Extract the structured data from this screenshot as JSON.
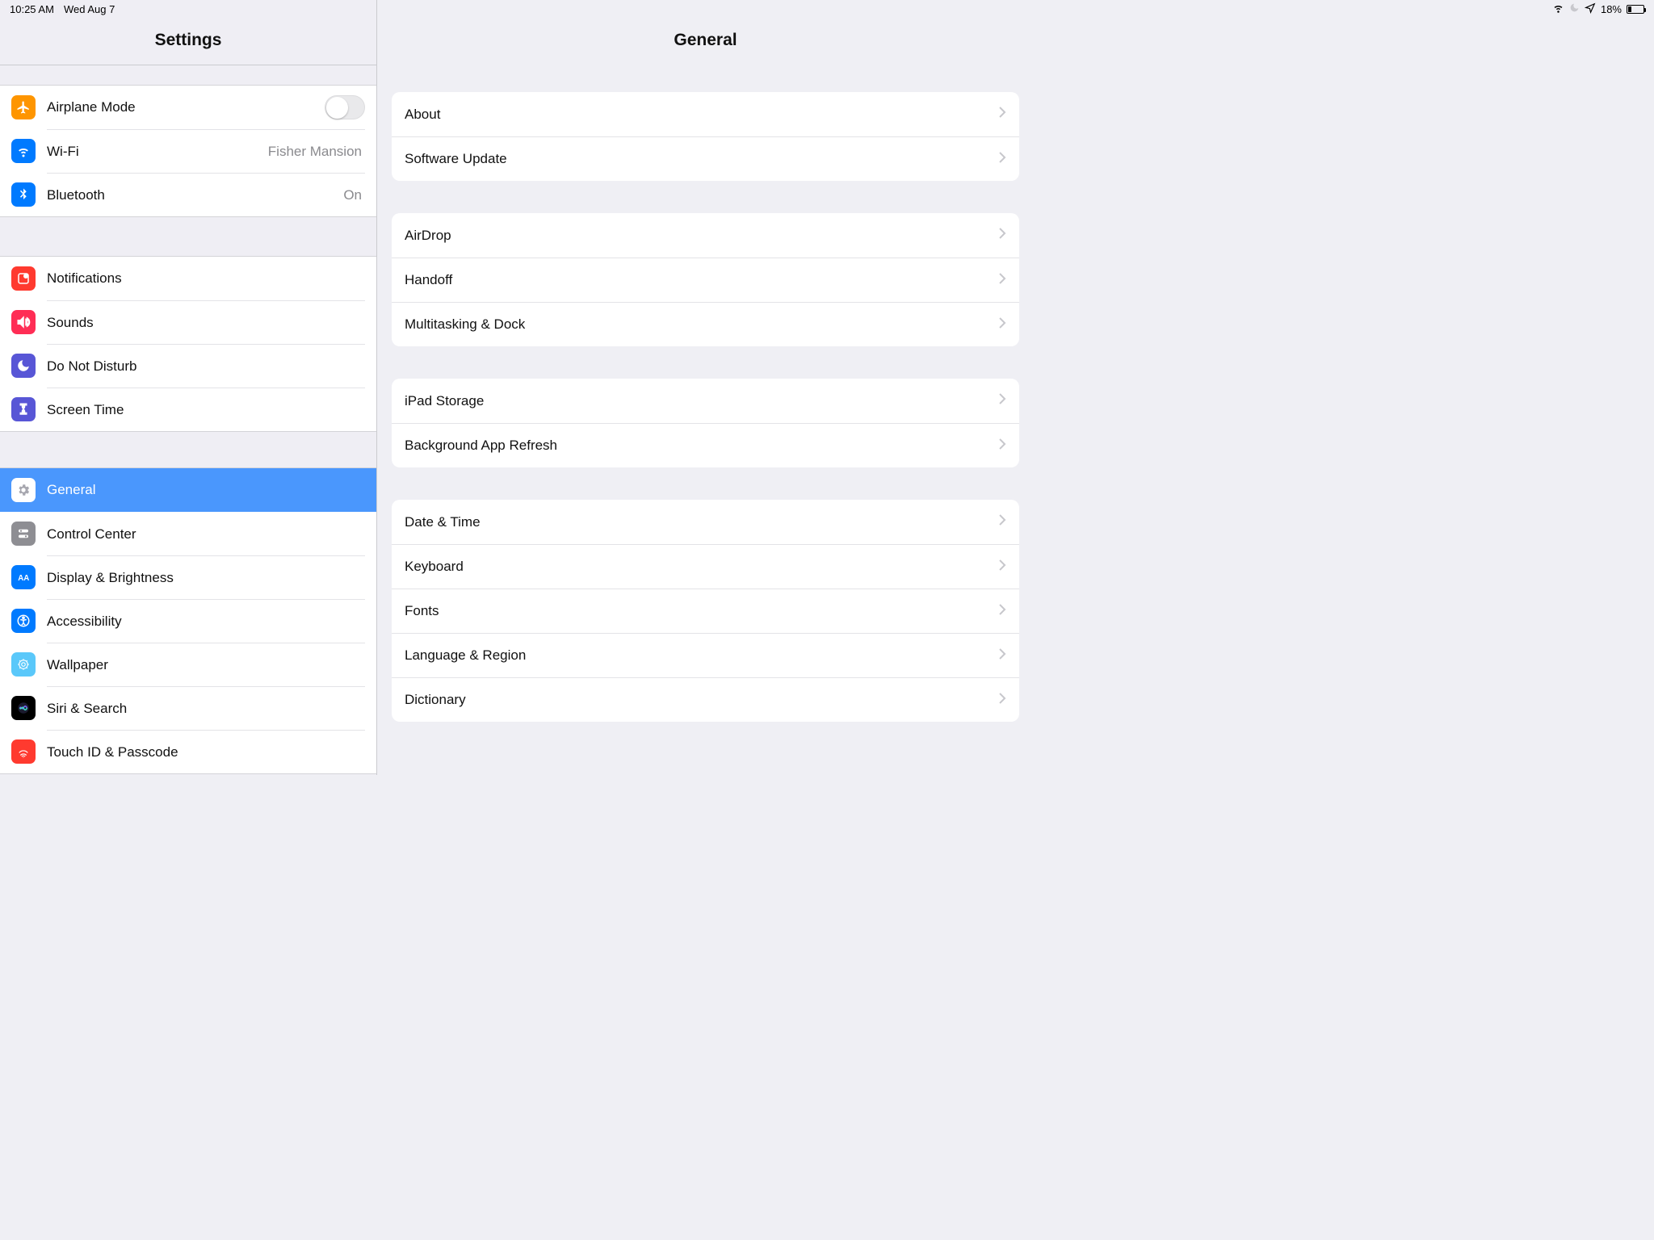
{
  "status": {
    "time": "10:25 AM",
    "date": "Wed Aug 7",
    "battery_pct": "18%"
  },
  "sidebar": {
    "title": "Settings",
    "groups": [
      [
        {
          "id": "airplane",
          "label": "Airplane Mode",
          "value": "",
          "type": "toggle",
          "color": "#fe9500"
        },
        {
          "id": "wifi",
          "label": "Wi-Fi",
          "value": "Fisher Mansion",
          "color": "#007aff"
        },
        {
          "id": "bluetooth",
          "label": "Bluetooth",
          "value": "On",
          "color": "#007aff"
        }
      ],
      [
        {
          "id": "notifications",
          "label": "Notifications",
          "color": "#ff3a2f"
        },
        {
          "id": "sounds",
          "label": "Sounds",
          "color": "#ff2d55"
        },
        {
          "id": "dnd",
          "label": "Do Not Disturb",
          "color": "#5856d6"
        },
        {
          "id": "screentime",
          "label": "Screen Time",
          "color": "#5856d6"
        }
      ],
      [
        {
          "id": "general",
          "label": "General",
          "color": "#8e8e93",
          "selected": true
        },
        {
          "id": "controlcenter",
          "label": "Control Center",
          "color": "#8e8e93"
        },
        {
          "id": "display",
          "label": "Display & Brightness",
          "color": "#007aff"
        },
        {
          "id": "accessibility",
          "label": "Accessibility",
          "color": "#007aff"
        },
        {
          "id": "wallpaper",
          "label": "Wallpaper",
          "color": "#5ac8fa"
        },
        {
          "id": "siri",
          "label": "Siri & Search",
          "color": "#000"
        },
        {
          "id": "touchid",
          "label": "Touch ID & Passcode",
          "color": "#ff3a2f"
        }
      ]
    ]
  },
  "main": {
    "title": "General",
    "sections": [
      [
        "About",
        "Software Update"
      ],
      [
        "AirDrop",
        "Handoff",
        "Multitasking & Dock"
      ],
      [
        "iPad Storage",
        "Background App Refresh"
      ],
      [
        "Date & Time",
        "Keyboard",
        "Fonts",
        "Language & Region",
        "Dictionary"
      ]
    ]
  }
}
